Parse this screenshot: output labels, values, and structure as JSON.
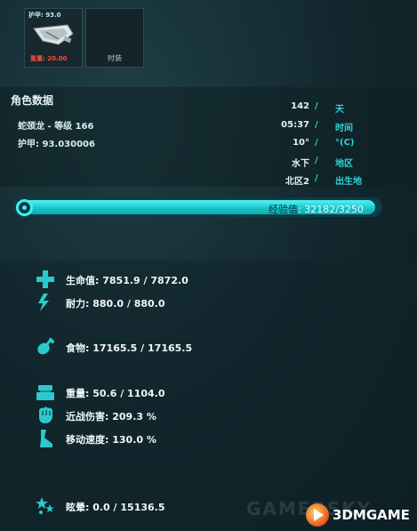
{
  "equipment": {
    "armor_slot": {
      "armor_label": "护甲: 93.0",
      "weight_label": "重量: 20.00"
    },
    "costume_slot": {
      "label": "时装"
    }
  },
  "character": {
    "title": "角色数据",
    "species_line": "蛇颈龙  -  等级  166",
    "armor_line": "护甲: 93.030006",
    "info": [
      {
        "value": "142",
        "sep": "/",
        "label": "天"
      },
      {
        "value": "05:37",
        "sep": "/",
        "label": "时间"
      },
      {
        "value": "10°",
        "sep": "/",
        "label": "°(C)"
      },
      {
        "value": "水下",
        "sep": "/",
        "label": "地区"
      },
      {
        "value": "北区2",
        "sep": "/",
        "label": "出生地"
      }
    ]
  },
  "experience": {
    "label": "经验值",
    "text": "32182/3250",
    "fill_fraction": 0.99
  },
  "stats": [
    {
      "icon": "health-cross-icon",
      "text": "生命值:  7851.9   /   7872.0"
    },
    {
      "icon": "stamina-bolt-icon",
      "text": "耐力:  880.0   /   880.0"
    },
    {
      "icon": "food-drumstick-icon",
      "text": "食物:  17165.5   /   17165.5"
    },
    {
      "icon": "weight-scale-icon",
      "text": "重量:  50.6   /   1104.0"
    },
    {
      "icon": "melee-fist-icon",
      "text": "近战伤害:  209.3   %"
    },
    {
      "icon": "movement-foot-icon",
      "text": "移动速度:  130.0   %"
    },
    {
      "icon": "torpor-stars-icon",
      "text": "眩晕:  0.0   /   15136.5"
    }
  ],
  "branding": {
    "watermark": "GAMERSKY",
    "logo": "3DMGAME"
  },
  "colors": {
    "accent": "#2dd3d6",
    "xp_bar": "#1ed3d7",
    "weight_red": "#ff4a3a",
    "background": "#13282e"
  }
}
